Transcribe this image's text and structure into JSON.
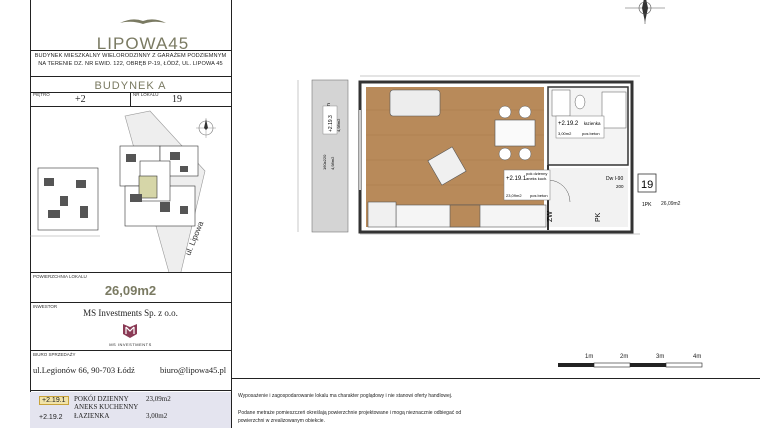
{
  "logo": {
    "name": "LIPOWA45"
  },
  "project": {
    "description_line1": "BUDYNEK MIESZKALNY WIELORODZINNY Z GARAŻEM PODZIEMNYM",
    "description_line2": "NA TERENIE DZ. NR EWID. 122, OBRĘB P-19, ŁÓDŹ, UL. LIPOWA 45",
    "building": "BUDYNEK A",
    "floor_label": "PIĘTRO",
    "floor_value": "+2",
    "unit_label": "NR LOKALU",
    "unit_value": "19",
    "area_label": "POWIERZCHNIA LOKALU",
    "area_value": "26,09m2",
    "investor_label": "INWESTOR",
    "investor_value": "MS Investments Sp. z o.o.",
    "investor_logo_text": "MS INVESTMENTS",
    "office_label": "BIURO SPRZEDAŻY",
    "office_address": "ul.Legionów 66, 90-703 Łódź",
    "office_email": "biuro@lipowa45.pl",
    "street_label": "ul. Lipowa"
  },
  "rooms": [
    {
      "id": "+2.19.1",
      "name_line1": "POKÓJ DZIENNY",
      "name_line2": "ANEKS KUCHENNY",
      "area": "23,09m2"
    },
    {
      "id": "+2.19.2",
      "name_line1": "ŁAZIENKA",
      "name_line2": "",
      "area": "3,00m2"
    }
  ],
  "notes": {
    "line1": "Wyposażenie i zagospodarowanie lokalu ma charakter poglądowy i nie stanowi oferty handlowej.",
    "line2": "Podane metraże pomieszczeń określają powierzchnie projektowane i mogą nieznacznie odbiegać od",
    "line3": "powierzchni w zrealizowanym obiekcie."
  },
  "plan": {
    "balcony_label": "balkon",
    "balcony_id": "+2.19.3",
    "balcony_area": "4,98m2",
    "living_id": "+2.19.1",
    "living_name1": "pok dzienny",
    "living_name2": "aneks kuch.",
    "living_area": "23,09m2",
    "living_floor": "pos beton",
    "bath_id": "+2.19.2",
    "bath_name": "łazienka",
    "bath_area": "3,00m2",
    "bath_floor": "pos beton",
    "door_label": "Dw I-90",
    "door_height": "200",
    "zw_label": "ZW",
    "pk_label": "PK",
    "unit_badge": "19",
    "badge_rooms": "1PK",
    "badge_area": "26,09m2",
    "window_spec": "160x220",
    "area_tag": "4,98m2"
  },
  "scale": {
    "marks": [
      "1m",
      "2m",
      "3m",
      "4m"
    ]
  },
  "colors": {
    "accent": "#7a7a62",
    "floor_wood": "#b88a5a",
    "room_band": "#e4e4ef"
  }
}
